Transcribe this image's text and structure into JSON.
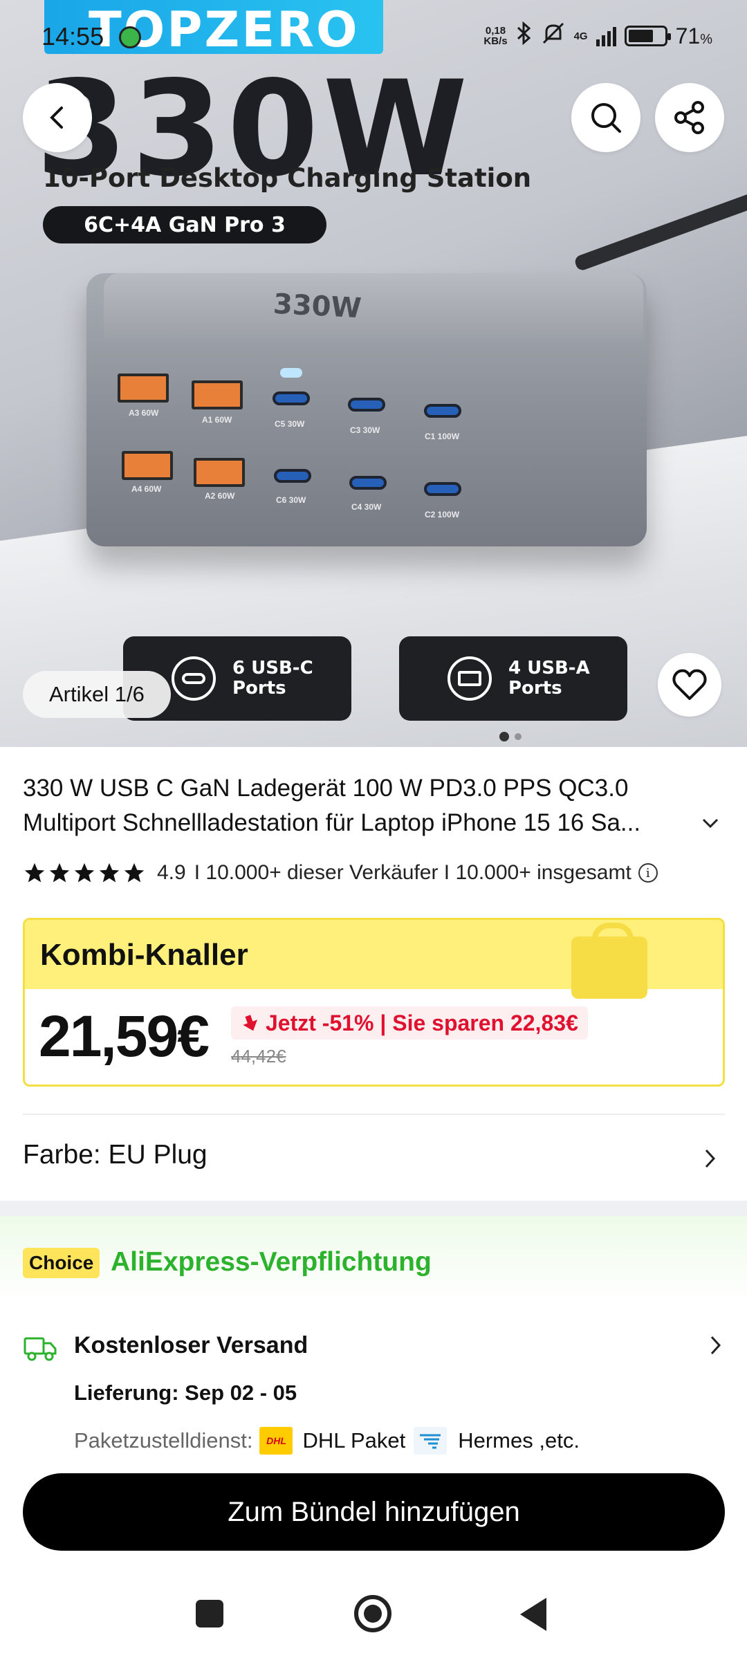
{
  "status_bar": {
    "time": "14:55",
    "net_speed_value": "0,18",
    "net_speed_unit": "KB/s",
    "network": "4G",
    "battery_pct": "71",
    "battery_unit": "%"
  },
  "hero": {
    "brand": "TOPZERO",
    "headline": "330W",
    "subtitle": "10-Port Desktop Charging Station",
    "pill": "6C+4A  GaN Pro 3",
    "charger_label": "330W",
    "port_labels": [
      "A3 60W",
      "A1 60W",
      "C5 30W",
      "C3 30W",
      "C1 100W",
      "A4 60W",
      "A2 60W",
      "C6 30W",
      "C4 30W",
      "C2 100W"
    ],
    "feature_usbc": "6 USB-C Ports",
    "feature_usba": "4 USB-A Ports",
    "article_counter": "Artikel 1/6"
  },
  "product": {
    "title_line1": "330 W USB C GaN Ladegerät 100 W PD3.0 PPS QC3.0",
    "title_line2": "Multiport Schnellladestation für Laptop iPhone 15 16 Sa...",
    "rating": "4.9",
    "sales_text": "I 10.000+ dieser Verkäufer I 10.000+ insgesamt"
  },
  "deal": {
    "banner": "Kombi-Knaller",
    "price": "21,59€",
    "discount": "Jetzt -51% | Sie sparen 22,83€",
    "old_price": "44,42€"
  },
  "variant": {
    "label": "Farbe: EU Plug"
  },
  "commitment": {
    "badge": "Choice",
    "text": "AliExpress-Verpflichtung"
  },
  "shipping": {
    "title": "Kostenloser Versand",
    "delivery": "Lieferung: Sep 02 - 05",
    "carrier_prefix": "Paketzustelldienst:",
    "carrier_dhl_logo": "DHL",
    "carrier_dhl": "DHL Paket",
    "carrier_hermes": "Hermes ,etc."
  },
  "cta": {
    "label": "Zum Bündel hinzufügen"
  },
  "colors": {
    "choice_green": "#2db22d",
    "discount_red": "#e0102f",
    "combo_yellow": "#fef07a"
  }
}
